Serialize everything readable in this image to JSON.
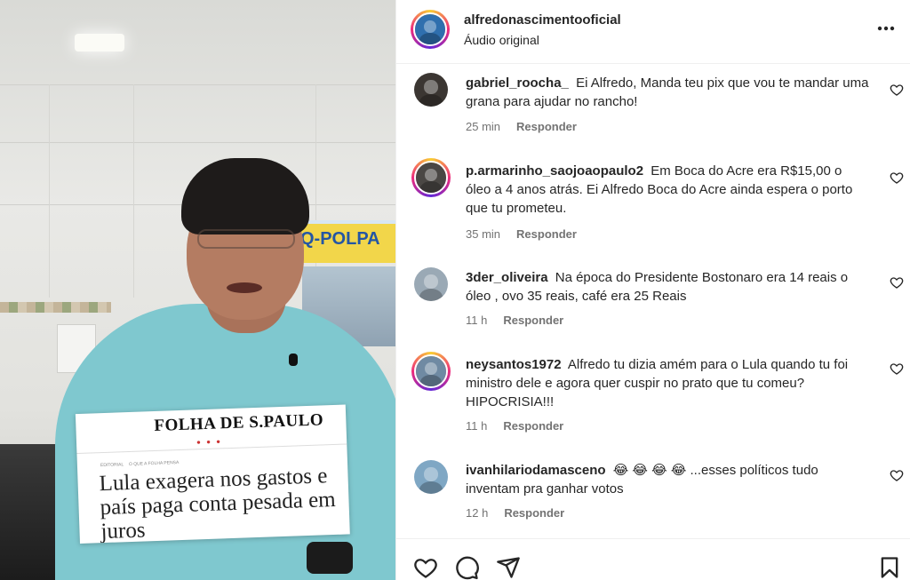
{
  "media": {
    "store_sign": "Q-POLPA",
    "clipping": {
      "masthead": "FOLHA DE S.PAULO",
      "dots": "● ● ●",
      "section": "EDITORIAL",
      "kicker": "O QUE A FOLHA PENSA",
      "headline": "Lula exagera nos gastos e país paga conta pesada em juros"
    }
  },
  "header": {
    "username": "alfredonascimentooficial",
    "subtitle": "Áudio original",
    "more_icon": "more-horizontal-icon"
  },
  "comments": [
    {
      "username": "gabriel_roocha_",
      "text": "Ei Alfredo, Manda teu pix que vou te mandar uma grana para ajudar no rancho!",
      "time": "25 min",
      "reply": "Responder",
      "story_ring": false,
      "avatar_color": "#3b3632"
    },
    {
      "username": "p.armarinho_saojoaopaulo2",
      "text": "Em Boca do Acre era R$15,00 o óleo a 4 anos atrás. Ei Alfredo Boca do Acre ainda espera o porto que tu prometeu.",
      "time": "35 min",
      "reply": "Responder",
      "story_ring": true,
      "avatar_color": "#4a4744"
    },
    {
      "username": "3der_oliveira",
      "text": "Na época do Presidente Bostonaro era 14 reais o óleo , ovo 35 reais, café era 25 Reais",
      "time": "11 h",
      "reply": "Responder",
      "story_ring": false,
      "avatar_color": "#9aa9b5"
    },
    {
      "username": "neysantos1972",
      "text": "Alfredo tu dizia amém para o Lula quando tu foi ministro dele e agora quer cuspir no prato que tu comeu? HIPOCRISIA!!!",
      "time": "11 h",
      "reply": "Responder",
      "story_ring": true,
      "avatar_color": "#6f8aa3"
    },
    {
      "username": "ivanhilariodamasceno",
      "text": "😂 😂 😂 😂 ...esses políticos tudo inventam pra ganhar votos",
      "time": "12 h",
      "reply": "Responder",
      "story_ring": false,
      "avatar_color": "#7fa7c4"
    }
  ],
  "footer": {
    "icons": [
      "heart-icon",
      "comment-icon",
      "share-icon",
      "bookmark-icon"
    ]
  },
  "colors": {
    "text": "#262626",
    "muted": "#737373",
    "divider": "#efefef",
    "shirt": "#7fc8cf"
  }
}
